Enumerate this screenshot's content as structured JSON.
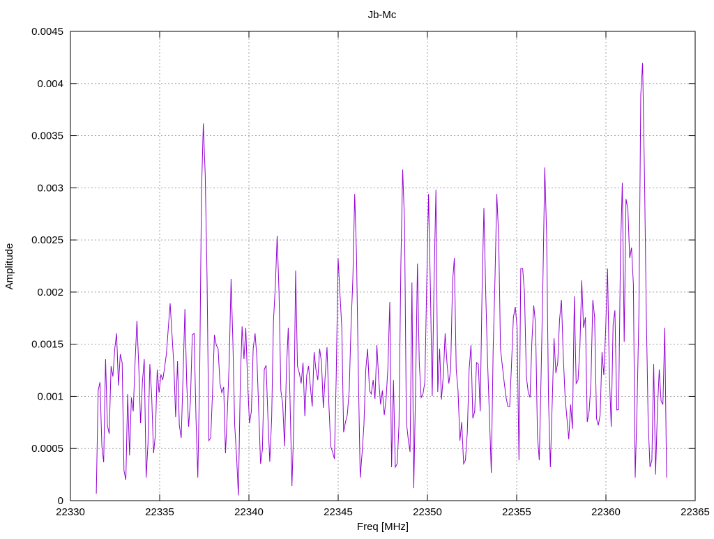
{
  "chart_data": {
    "type": "line",
    "title": "Jb-Mc",
    "xlabel": "Freq [MHz]",
    "ylabel": "Amplitude",
    "xlim": [
      22330,
      22365
    ],
    "ylim": [
      0,
      0.0045
    ],
    "x_ticks": [
      "22330",
      "22335",
      "22340",
      "22345",
      "22350",
      "22355",
      "22360",
      "22365"
    ],
    "y_ticks": [
      "0",
      "0.0005",
      "0.001",
      "0.0015",
      "0.002",
      "0.0025",
      "0.003",
      "0.0035",
      "0.004",
      "0.0045"
    ],
    "grid": true,
    "legend": "none",
    "series": [
      {
        "name": "Jb-Mc",
        "color": "#9400d3",
        "x_start": 22331.45,
        "x_end": 22363.4,
        "values": [
          6.7e-05,
          0.001056,
          0.001136,
          0.000521,
          0.000368,
          0.001357,
          0.000722,
          0.000642,
          0.00129,
          0.00119,
          0.001457,
          0.001604,
          0.001103,
          0.001404,
          0.001324,
          0.000287,
          0.0002,
          0.001023,
          0.000434,
          0.000989,
          0.000856,
          0.001324,
          0.001725,
          0.00129,
          0.000742,
          0.001143,
          0.001357,
          0.000221,
          0.000541,
          0.00131,
          0.001009,
          0.000455,
          0.000628,
          0.001257,
          0.001036,
          0.00121,
          0.001156,
          0.001277,
          0.00141,
          0.001658,
          0.001892,
          0.001604,
          0.001303,
          0.000802,
          0.001337,
          0.000722,
          0.000602,
          0.00119,
          0.001838,
          0.001123,
          0.000709,
          0.000956,
          0.001591,
          0.001604,
          0.000789,
          0.000221,
          0.001223,
          0.002961,
          0.003616,
          0.003128,
          0.002159,
          0.000575,
          0.000602,
          0.001056,
          0.001591,
          0.001491,
          0.001457,
          0.001123,
          0.001036,
          0.00109,
          0.000455,
          0.000856,
          0.001324,
          0.002126,
          0.001524,
          0.000722,
          0.000421,
          5e-05,
          0.001123,
          0.001671,
          0.001357,
          0.001658,
          0.001123,
          0.000742,
          0.000856,
          0.001457,
          0.001604,
          0.001377,
          0.000856,
          0.000354,
          0.000488,
          0.001257,
          0.001297,
          0.000789,
          0.000374,
          0.000789,
          0.001725,
          0.002059,
          0.00254,
          0.001992,
          0.001056,
          0.000922,
          0.000521,
          0.001257,
          0.001658,
          0.000922,
          0.00014,
          0.000722,
          0.002206,
          0.00129,
          0.001223,
          0.001123,
          0.001324,
          0.000809,
          0.001203,
          0.00129,
          0.00109,
          0.000902,
          0.001424,
          0.001257,
          0.001156,
          0.001457,
          0.001324,
          0.000889,
          0.00119,
          0.001471,
          0.000936,
          0.000521,
          0.000468,
          0.000401,
          0.00119,
          0.002326,
          0.001992,
          0.001658,
          0.000655,
          0.000755,
          0.000822,
          0.001056,
          0.001658,
          0.002139,
          0.002941,
          0.00236,
          0.00119,
          0.000221,
          0.000455,
          0.000722,
          0.001257,
          0.001457,
          0.001056,
          0.001023,
          0.001156,
          0.000976,
          0.001491,
          0.00117,
          0.000922,
          0.001056,
          0.000822,
          0.000976,
          0.00127,
          0.001905,
          0.000321,
          0.001156,
          0.000321,
          0.000354,
          0.000722,
          0.002259,
          0.003175,
          0.00266,
          0.000755,
          0.000588,
          0.000468,
          0.002092,
          0.00012,
          0.001056,
          0.002273,
          0.001324,
          0.000989,
          0.001023,
          0.001136,
          0.002045,
          0.002941,
          0.002059,
          0.001003,
          0.002092,
          0.002981,
          0.001043,
          0.001457,
          0.000969,
          0.001203,
          0.001604,
          0.001324,
          0.001123,
          0.001257,
          0.002092,
          0.002326,
          0.001257,
          0.001056,
          0.000575,
          0.000755,
          0.000354,
          0.000388,
          0.000655,
          0.001257,
          0.001491,
          0.000789,
          0.000856,
          0.001324,
          0.00131,
          0.000856,
          0.001992,
          0.002807,
          0.001992,
          0.001324,
          0.000822,
          0.000267,
          0.001424,
          0.002126,
          0.002941,
          0.002527,
          0.001457,
          0.00129,
          0.001136,
          0.000989,
          0.000902,
          0.000902,
          0.001324,
          0.001758,
          0.001858,
          0.001658,
          0.000388,
          0.002226,
          0.002226,
          0.001992,
          0.00119,
          0.001043,
          0.000989,
          0.001524,
          0.001872,
          0.001691,
          0.000622,
          0.000388,
          0.00119,
          0.002126,
          0.003195,
          0.00254,
          0.000989,
          0.000321,
          0.000922,
          0.001557,
          0.001223,
          0.001324,
          0.001738,
          0.001925,
          0.00139,
          0.000989,
          0.000789,
          0.000588,
          0.000922,
          0.000689,
          0.001959,
          0.001123,
          0.001156,
          0.001457,
          0.002112,
          0.001658,
          0.001758,
          0.000755,
          0.000856,
          0.001136,
          0.001925,
          0.001758,
          0.000789,
          0.000722,
          0.000822,
          0.001424,
          0.001203,
          0.001658,
          0.002226,
          0.00119,
          0.000709,
          0.001691,
          0.001825,
          0.000869,
          0.000876,
          0.002393,
          0.003048,
          0.001524,
          0.002894,
          0.002794,
          0.002326,
          0.002426,
          0.002072,
          0.000221,
          0.000922,
          0.001791,
          0.003897,
          0.004198,
          0.003128,
          0.001791,
          0.000755,
          0.000321,
          0.000388,
          0.00131,
          0.00025,
          0.000856,
          0.001257,
          0.000956,
          0.000922,
          0.001658,
          0.000221
        ]
      }
    ]
  }
}
